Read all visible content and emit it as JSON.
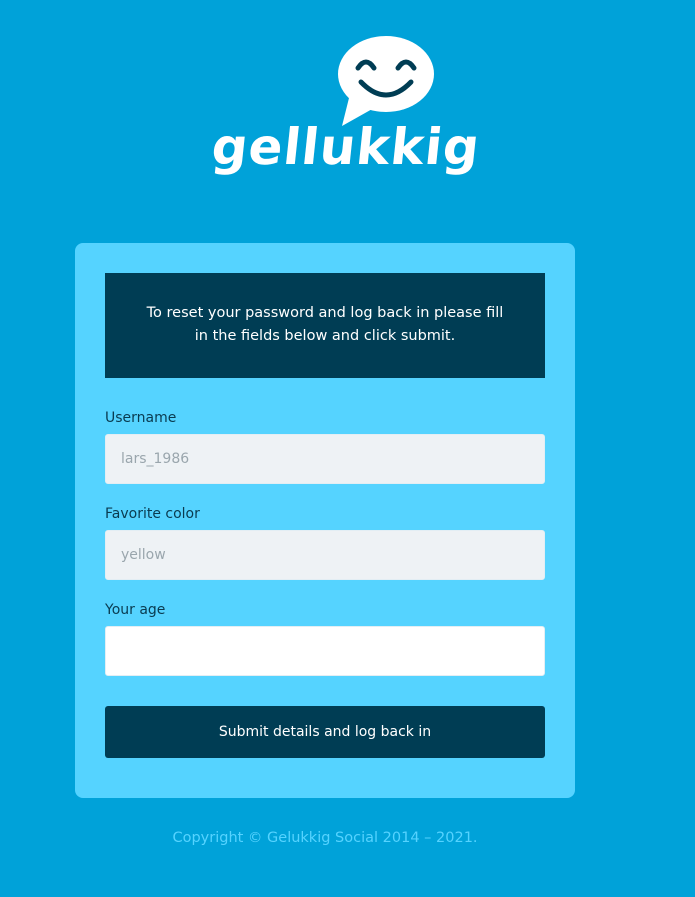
{
  "brand": {
    "name": "gellukkig"
  },
  "notice": {
    "text": "To reset your password and log back in please fill in the fields below and click submit."
  },
  "form": {
    "username": {
      "label": "Username",
      "value": "lars_1986"
    },
    "favorite_color": {
      "label": "Favorite color",
      "value": "yellow"
    },
    "age": {
      "label": "Your age",
      "value": ""
    },
    "submit_label": "Submit details and log back in"
  },
  "footer": {
    "copyright": "Copyright © Gelukkig Social 2014 – 2021."
  },
  "colors": {
    "background": "#00a2d9",
    "card": "#55d3ff",
    "dark": "#003d54",
    "readonly_field": "#eef2f5"
  },
  "icons": {
    "logo": "smiley-speech-bubble-icon"
  }
}
